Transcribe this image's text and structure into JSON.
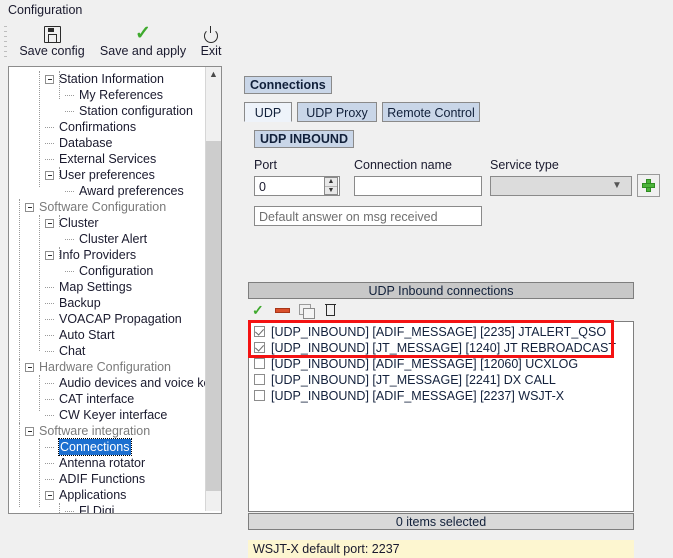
{
  "window": {
    "title": "Configuration"
  },
  "toolbar": {
    "save_config": {
      "label": "Save config",
      "icon": "floppy-disk-icon"
    },
    "save_and_apply": {
      "label": "Save and apply",
      "icon": "green-check-icon"
    },
    "exit": {
      "label": "Exit",
      "icon": "power-icon"
    }
  },
  "sidebar": {
    "items": [
      {
        "label": "Station Information",
        "indent": 1,
        "type": "expandable",
        "expanded": true,
        "selected": false
      },
      {
        "label": "My References",
        "indent": 2,
        "type": "leaf",
        "selected": false
      },
      {
        "label": "Station configuration",
        "indent": 2,
        "type": "leaf",
        "selected": false
      },
      {
        "label": "Confirmations",
        "indent": 1,
        "type": "leaf",
        "selected": false
      },
      {
        "label": "Database",
        "indent": 1,
        "type": "leaf",
        "selected": false
      },
      {
        "label": "External Services",
        "indent": 1,
        "type": "leaf",
        "selected": false
      },
      {
        "label": "User preferences",
        "indent": 1,
        "type": "expandable",
        "expanded": true,
        "selected": false
      },
      {
        "label": "Award preferences",
        "indent": 2,
        "type": "leaf",
        "selected": false
      },
      {
        "label": "Software Configuration",
        "indent": 0,
        "type": "group",
        "expanded": true,
        "selected": false
      },
      {
        "label": "Cluster",
        "indent": 1,
        "type": "expandable",
        "expanded": true,
        "selected": false
      },
      {
        "label": "Cluster Alert",
        "indent": 2,
        "type": "leaf",
        "selected": false
      },
      {
        "label": "Info Providers",
        "indent": 1,
        "type": "expandable",
        "expanded": true,
        "selected": false
      },
      {
        "label": "Configuration",
        "indent": 2,
        "type": "leaf",
        "selected": false
      },
      {
        "label": "Map Settings",
        "indent": 1,
        "type": "leaf",
        "selected": false
      },
      {
        "label": "Backup",
        "indent": 1,
        "type": "leaf",
        "selected": false
      },
      {
        "label": "VOACAP Propagation",
        "indent": 1,
        "type": "leaf",
        "selected": false
      },
      {
        "label": "Auto Start",
        "indent": 1,
        "type": "leaf",
        "selected": false
      },
      {
        "label": "Chat",
        "indent": 1,
        "type": "leaf",
        "selected": false
      },
      {
        "label": "Hardware Configuration",
        "indent": 0,
        "type": "group",
        "expanded": true,
        "selected": false
      },
      {
        "label": "Audio devices and voice keye",
        "indent": 1,
        "type": "leaf",
        "selected": false
      },
      {
        "label": "CAT interface",
        "indent": 1,
        "type": "leaf",
        "selected": false
      },
      {
        "label": "CW Keyer interface",
        "indent": 1,
        "type": "leaf",
        "selected": false
      },
      {
        "label": "Software integration",
        "indent": 0,
        "type": "group",
        "expanded": true,
        "selected": false
      },
      {
        "label": "Connections",
        "indent": 1,
        "type": "leaf",
        "selected": true
      },
      {
        "label": "Antenna rotator",
        "indent": 1,
        "type": "leaf",
        "selected": false
      },
      {
        "label": "ADIF Functions",
        "indent": 1,
        "type": "leaf",
        "selected": false
      },
      {
        "label": "Applications",
        "indent": 1,
        "type": "expandable",
        "expanded": true,
        "selected": false
      },
      {
        "label": "Fl Digi",
        "indent": 2,
        "type": "leaf",
        "selected": false
      }
    ],
    "scrollbar": {
      "up_arrow": "chevron-up-icon"
    }
  },
  "main": {
    "panel_title": "Connections",
    "tabs": [
      {
        "label": "UDP",
        "active": true
      },
      {
        "label": "UDP Proxy",
        "active": false
      },
      {
        "label": "Remote Control",
        "active": false
      }
    ],
    "section_title": "UDP INBOUND",
    "form": {
      "port": {
        "label": "Port",
        "value": "0"
      },
      "connection_name": {
        "label": "Connection name",
        "value": ""
      },
      "service_type": {
        "label": "Service type",
        "value": "",
        "enabled": false
      },
      "default_answer": {
        "placeholder": "Default answer on msg received",
        "value": ""
      },
      "add_button": {
        "icon": "green-plus-icon"
      }
    },
    "list": {
      "header": "UDP Inbound connections",
      "toolbar": [
        {
          "icon": "green-check-icon",
          "name": "enable-selected"
        },
        {
          "icon": "red-minus-icon",
          "name": "disable-selected"
        },
        {
          "icon": "copy-icon",
          "name": "duplicate-selected"
        },
        {
          "icon": "trash-icon",
          "name": "delete-selected"
        }
      ],
      "rows": [
        {
          "checked": true,
          "text": "[UDP_INBOUND] [ADIF_MESSAGE] [2235] JTALERT_QSO"
        },
        {
          "checked": true,
          "text": "[UDP_INBOUND] [JT_MESSAGE] [1240] JT REBROADCAST"
        },
        {
          "checked": false,
          "text": "[UDP_INBOUND] [ADIF_MESSAGE] [12060] UCXLOG"
        },
        {
          "checked": false,
          "text": "[UDP_INBOUND] [JT_MESSAGE] [2241] DX CALL"
        },
        {
          "checked": false,
          "text": "[UDP_INBOUND] [ADIF_MESSAGE] [2237] WSJT-X"
        }
      ],
      "status": "0 items selected"
    },
    "note": "WSJT-X default port: 2237"
  },
  "annotation": {
    "highlight_color": "#f41212",
    "covers_rows": [
      0,
      1
    ]
  }
}
